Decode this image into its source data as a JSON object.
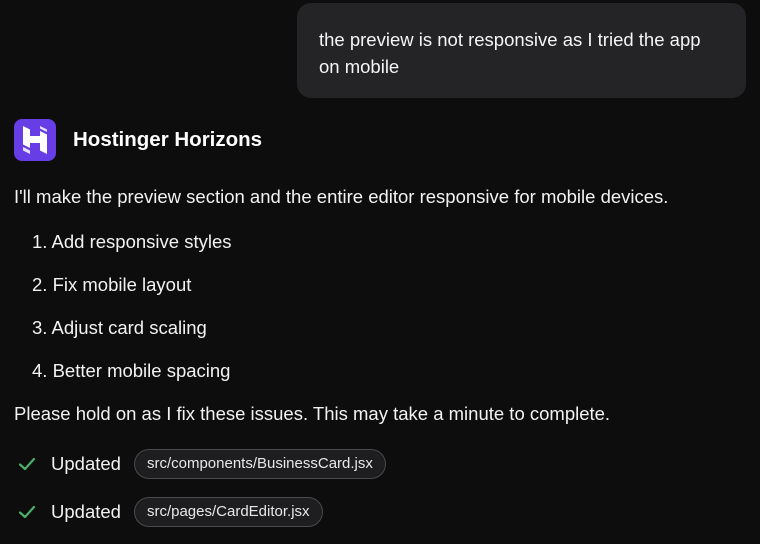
{
  "user_message": {
    "line1": "the preview is not responsive as I tried the app",
    "line2": "on mobile"
  },
  "assistant": {
    "name": "Hostinger Horizons",
    "logo_icon": "hostinger-logo-icon",
    "brand_color": "#673de6",
    "intro": "I'll make the preview section and the entire editor responsive for mobile devices.",
    "steps": [
      "1. Add responsive styles",
      "2. Fix mobile layout",
      "3. Adjust card scaling",
      "4. Better mobile spacing"
    ],
    "hold_message": "Please hold on as I fix these issues. This may take a minute to complete.",
    "updates": [
      {
        "status": "Updated",
        "icon": "check-icon",
        "file": "src/components/BusinessCard.jsx"
      },
      {
        "status": "Updated",
        "icon": "check-icon",
        "file": "src/pages/CardEditor.jsx"
      }
    ],
    "check_color": "#4caf6a"
  }
}
